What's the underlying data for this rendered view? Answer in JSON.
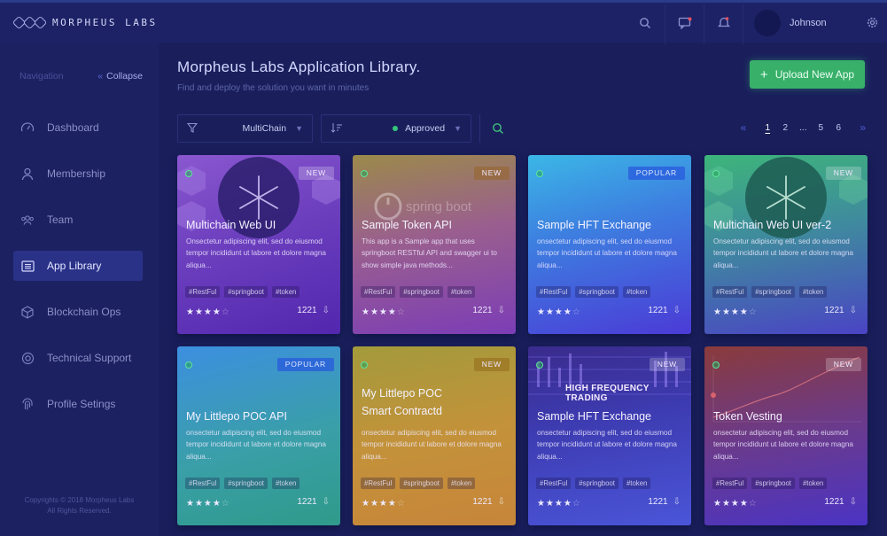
{
  "brand": {
    "name": "MORPHEUS LABS"
  },
  "topbar": {
    "search_icon": "search-icon",
    "chat_icon": "chat-icon",
    "bell_icon": "bell-icon",
    "user_name": "Johnson",
    "settings_icon": "gear-icon"
  },
  "sidebar": {
    "nav_label": "Navigation",
    "collapse_label": "Collapse",
    "items": [
      {
        "label": "Dashboard",
        "icon": "gauge-icon",
        "active": false
      },
      {
        "label": "Membership",
        "icon": "user-icon",
        "active": false
      },
      {
        "label": "Team",
        "icon": "team-icon",
        "active": false
      },
      {
        "label": "App Library",
        "icon": "library-icon",
        "active": true
      },
      {
        "label": "Blockchain Ops",
        "icon": "cube-icon",
        "active": false
      },
      {
        "label": "Technical Support",
        "icon": "support-icon",
        "active": false
      },
      {
        "label": "Profile Setings",
        "icon": "fingerprint-icon",
        "active": false
      }
    ],
    "copyright_line1": "Copyrights © 2018 Morpheus Labs",
    "copyright_line2": "All Rights Reserved."
  },
  "main": {
    "title": "Morpheus Labs Application Library.",
    "subtitle": "Find and deploy the solution you want in minutes",
    "upload_label": "Upload New App",
    "filters": {
      "chain_value": "MultiChain",
      "status_value": "Approved"
    },
    "pagination": {
      "prev": "«",
      "pages": [
        "1",
        "2",
        "...",
        "5",
        "6"
      ],
      "current": "1",
      "next": "»"
    }
  },
  "colors": {
    "accent_green": "#38b06a",
    "sidebar_active": "#2a3288",
    "background": "#1a1f5c"
  },
  "cards": [
    {
      "title": "Multichain Web UI",
      "badge": "NEW",
      "desc": "Onsectetur adipiscing elit, sed do eiusmod tempor incididunt ut labore et dolore magna aliqua...",
      "tags": [
        "#RestFul",
        "#springboot",
        "#token"
      ],
      "rating": 4,
      "count": "1221"
    },
    {
      "title": "Sample Token API",
      "badge": "NEW",
      "desc": "This app is a Sample app that uses springboot RESTful API and swagger ui to show simple java methods...",
      "tags": [
        "#RestFul",
        "#springboot",
        "#token"
      ],
      "rating": 4,
      "count": "1221",
      "art_text": "spring boot"
    },
    {
      "title": "Sample HFT Exchange",
      "badge": "POPULAR",
      "desc": "onsectetur adipiscing elit, sed do eiusmod tempor incididunt ut labore et dolore magna aliqua...",
      "tags": [
        "#RestFul",
        "#springboot",
        "#token"
      ],
      "rating": 4,
      "count": "1221"
    },
    {
      "title": "Multichain Web UI ver-2",
      "badge": "NEW",
      "desc": "Onsectetur adipiscing elit, sed do eiusmod tempor incididunt ut labore et dolore magna aliqua...",
      "tags": [
        "#RestFul",
        "#springboot",
        "#token"
      ],
      "rating": 4,
      "count": "1221"
    },
    {
      "title": "My Littlepo POC API",
      "badge": "POPULAR",
      "desc": "onsectetur adipiscing elit, sed do eiusmod tempor incididunt ut labore et dolore magna aliqua...",
      "tags": [
        "#RestFul",
        "#springboot",
        "#token"
      ],
      "rating": 4,
      "count": "1221"
    },
    {
      "title": "My Littlepo POC Smart Contractd",
      "badge": "NEW",
      "desc": "onsectetur adipiscing elit, sed do eiusmod tempor incididunt ut labore et dolore magna aliqua...",
      "tags": [
        "#RestFul",
        "#springboot",
        "#token"
      ],
      "rating": 4,
      "count": "1221"
    },
    {
      "title": "Sample HFT Exchange",
      "badge": "NEW",
      "desc": "onsectetur adipiscing elit, sed do eiusmod tempor incididunt ut labore et dolore magna aliqua...",
      "tags": [
        "#RestFul",
        "#springboot",
        "#token"
      ],
      "rating": 4,
      "count": "1221",
      "art_text": "HIGH FREQUENCY TRADING"
    },
    {
      "title": "Token Vesting",
      "badge": "NEW",
      "desc": "onsectetur adipiscing elit, sed do eiusmod tempor incididunt ut labore et dolore magna aliqua...",
      "tags": [
        "#RestFul",
        "#springboot",
        "#token"
      ],
      "rating": 4,
      "count": "1221"
    }
  ]
}
